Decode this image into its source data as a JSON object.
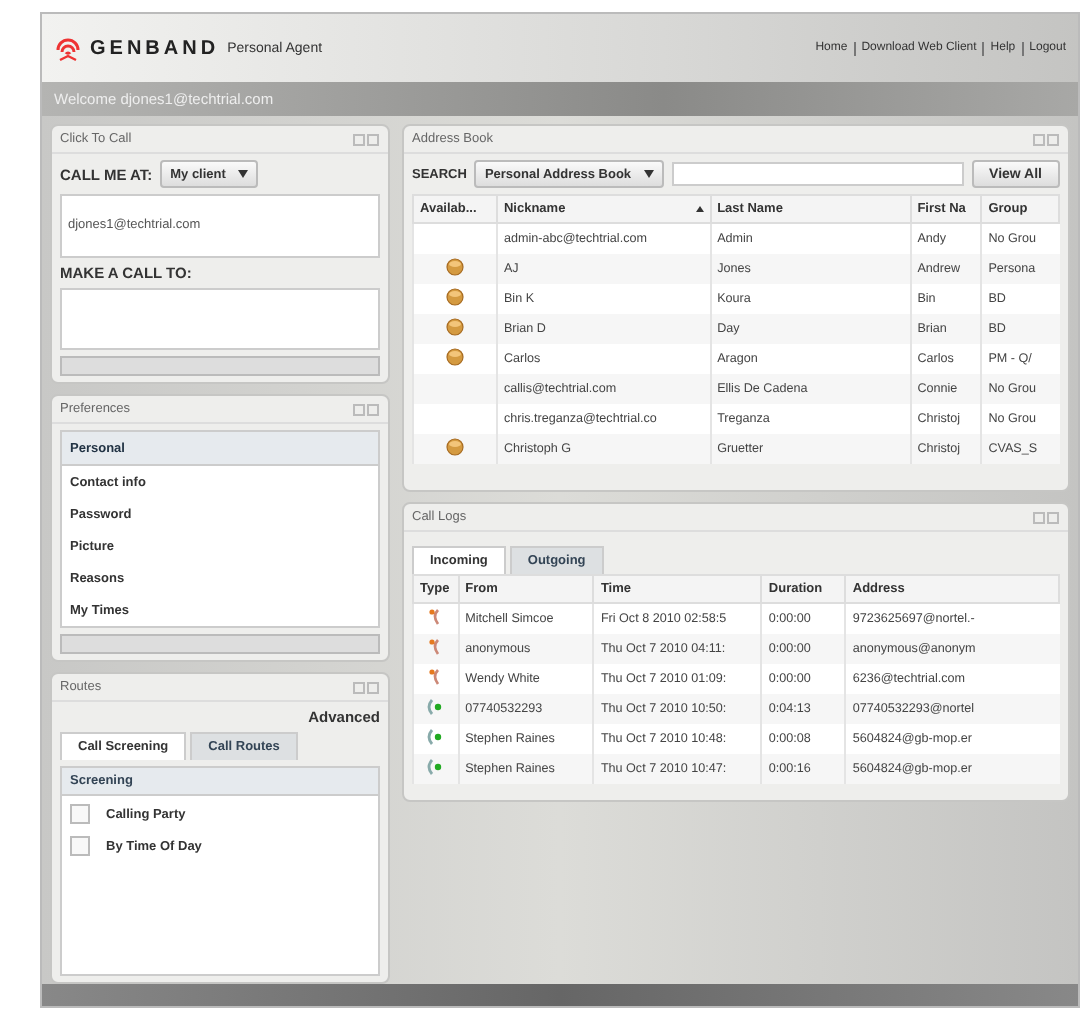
{
  "header": {
    "brand": "GENBAND",
    "product": "Personal Agent",
    "links": [
      "Home",
      "Download Web Client",
      "Help",
      "Logout"
    ],
    "welcome": "Welcome djones1@techtrial.com"
  },
  "click_to_call": {
    "title": "Click To Call",
    "call_me_label": "CALL ME AT:",
    "call_me_value": "My client",
    "address_value": "djones1@techtrial.com",
    "make_call_label": "MAKE A CALL TO:"
  },
  "preferences": {
    "title": "Preferences",
    "items": [
      {
        "label": "Personal",
        "selected": true
      },
      {
        "label": "Contact info",
        "selected": false
      },
      {
        "label": "Password",
        "selected": false
      },
      {
        "label": "Picture",
        "selected": false
      },
      {
        "label": "Reasons",
        "selected": false
      },
      {
        "label": "My Times",
        "selected": false
      }
    ]
  },
  "routes": {
    "title": "Routes",
    "advanced": "Advanced",
    "tabs": [
      {
        "label": "Call Screening",
        "selected": true
      },
      {
        "label": "Call Routes",
        "selected": false
      }
    ],
    "section": "Screening",
    "options": [
      {
        "label": "Calling Party",
        "checked": false
      },
      {
        "label": "By Time Of Day",
        "checked": false
      }
    ]
  },
  "address_book": {
    "title": "Address Book",
    "search_label": "SEARCH",
    "source": "Personal Address Book",
    "view_all": "View All",
    "columns": [
      "Availab...",
      "Nickname",
      "Last Name",
      "First Na",
      "Group"
    ],
    "rows": [
      {
        "available": false,
        "cells": [
          "",
          "admin-abc@techtrial.com",
          "Admin",
          "Andy",
          "No Grou"
        ]
      },
      {
        "available": true,
        "cells": [
          "",
          "AJ",
          "Jones",
          "Andrew",
          "Persona"
        ]
      },
      {
        "available": true,
        "cells": [
          "",
          "Bin K",
          "Koura",
          "Bin",
          "BD"
        ]
      },
      {
        "available": true,
        "cells": [
          "",
          "Brian D",
          "Day",
          "Brian",
          "BD"
        ]
      },
      {
        "available": true,
        "cells": [
          "",
          "Carlos",
          "Aragon",
          "Carlos",
          "PM - Q/"
        ]
      },
      {
        "available": false,
        "cells": [
          "",
          "callis@techtrial.com",
          "Ellis De Cadena",
          "Connie",
          "No Grou"
        ]
      },
      {
        "available": false,
        "cells": [
          "",
          "chris.treganza@techtrial.co",
          "Treganza",
          "Christoj",
          "No Grou"
        ]
      },
      {
        "available": true,
        "cells": [
          "",
          "Christoph G",
          "Gruetter",
          "Christoj",
          "CVAS_S"
        ]
      }
    ]
  },
  "call_logs": {
    "title": "Call Logs",
    "tabs": [
      {
        "label": "Incoming",
        "selected": true
      },
      {
        "label": "Outgoing",
        "selected": false
      }
    ],
    "columns": [
      "Type",
      "From",
      "Time",
      "Duration",
      "Address"
    ],
    "rows": [
      {
        "kind": "missed",
        "cells": [
          "",
          "Mitchell Simcoe",
          "Fri Oct 8 2010 02:58:5",
          "0:00:00",
          "9723625697@nortel.-"
        ]
      },
      {
        "kind": "missed",
        "cells": [
          "",
          "anonymous",
          "Thu Oct 7 2010 04:11:",
          "0:00:00",
          "anonymous@anonym"
        ]
      },
      {
        "kind": "missed",
        "cells": [
          "",
          "Wendy White",
          "Thu Oct 7 2010 01:09:",
          "0:00:00",
          "6236@techtrial.com"
        ]
      },
      {
        "kind": "answered",
        "cells": [
          "",
          "07740532293",
          "Thu Oct 7 2010 10:50:",
          "0:04:13",
          "07740532293@nortel"
        ]
      },
      {
        "kind": "answered",
        "cells": [
          "",
          "Stephen Raines",
          "Thu Oct 7 2010 10:48:",
          "0:00:08",
          "5604824@gb-mop.er"
        ]
      },
      {
        "kind": "answered",
        "cells": [
          "",
          "Stephen Raines",
          "Thu Oct 7 2010 10:47:",
          "0:00:16",
          "5604824@gb-mop.er"
        ]
      }
    ]
  }
}
